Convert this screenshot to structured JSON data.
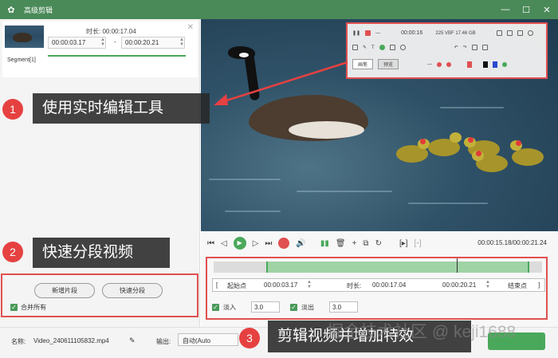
{
  "window": {
    "title": "高级剪辑",
    "minimize": "—",
    "maximize": "☐",
    "close": "✕"
  },
  "segment": {
    "duration_label": "时长: 00:00:17.04",
    "start_time": "00:00:03.17",
    "separator": "-",
    "end_time": "00:00:20.21",
    "label": "Segment[1]",
    "close_glyph": "✕"
  },
  "left_actions": {
    "new_segment": "新增片段",
    "quick_split": "快速分段",
    "merge_all": "合并所有"
  },
  "toolbar_overlay": {
    "time": "00:00:16",
    "status": "225 VBF  17.46 GB",
    "left_tab": "画笔",
    "right_tab": "预览"
  },
  "callouts": [
    {
      "number": "1",
      "text": "使用实时编辑工具"
    },
    {
      "number": "2",
      "text": "快速分段视频"
    },
    {
      "number": "3",
      "text": "剪辑视频并增加特效"
    }
  ],
  "playback": {
    "timecode": "00:00:15.18/00:00:21.24"
  },
  "edit": {
    "start_btn": "起始点",
    "start_time": "00:00:03.17",
    "duration_label": "时长:",
    "duration": "00:00:17.04",
    "end_time": "00:00:20.21",
    "end_btn": "结束点",
    "fade_in_label": "淡入",
    "fade_in_value": "3.0",
    "fade_out_label": "淡出",
    "fade_out_value": "3.0"
  },
  "footer": {
    "name_label": "名称:",
    "name_value": "Video_240611105832.mp4",
    "output_label": "输出:",
    "output_value": "自动(Auto"
  },
  "watermark": "掘金技术社区 @ keji1688"
}
